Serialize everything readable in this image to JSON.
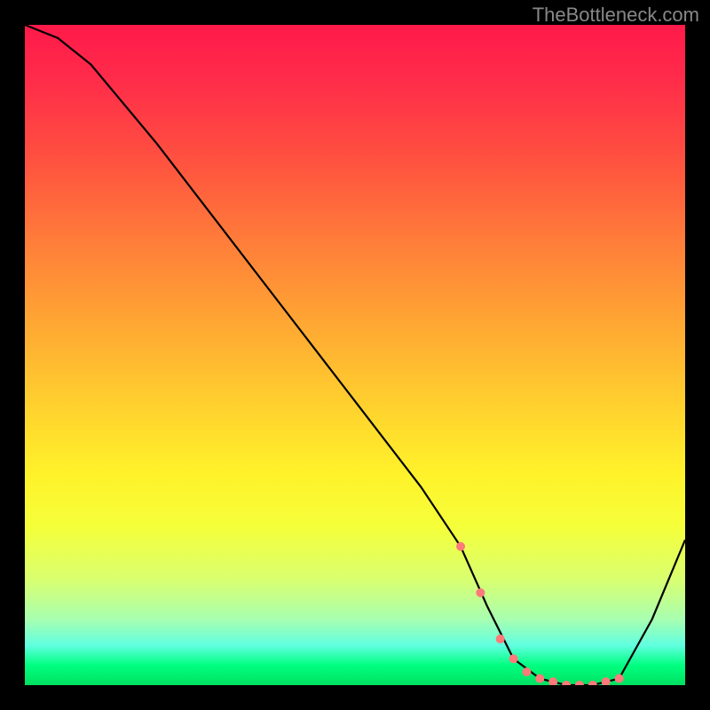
{
  "attribution": "TheBottleneck.com",
  "chart_data": {
    "type": "line",
    "title": "",
    "xlabel": "",
    "ylabel": "",
    "xlim": [
      0,
      100
    ],
    "ylim": [
      0,
      100
    ],
    "grid": false,
    "legend": false,
    "series": [
      {
        "name": "curve",
        "x": [
          0,
          5,
          10,
          20,
          30,
          40,
          50,
          60,
          66,
          70,
          74,
          78,
          82,
          86,
          90,
          95,
          100
        ],
        "y": [
          100,
          98,
          94,
          82,
          69,
          56,
          43,
          30,
          21,
          12,
          4,
          1,
          0,
          0,
          1,
          10,
          22
        ]
      }
    ],
    "markers": {
      "name": "highlight-points",
      "color": "#ff7a7a",
      "x": [
        66,
        69,
        72,
        74,
        76,
        78,
        80,
        82,
        84,
        86,
        88,
        90
      ],
      "y": [
        21,
        14,
        7,
        4,
        2,
        1,
        0.5,
        0,
        0,
        0,
        0.5,
        1
      ]
    },
    "background_gradient": {
      "top": "#ff1a4a",
      "bottom": "#00e060"
    }
  }
}
